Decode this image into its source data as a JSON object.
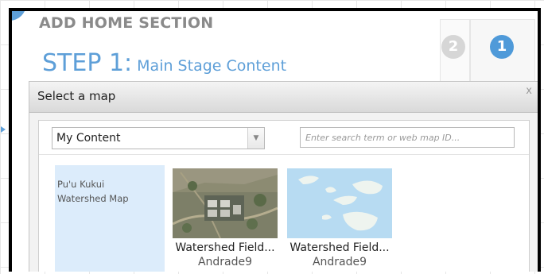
{
  "wizard": {
    "title": "ADD HOME SECTION",
    "step_label": "STEP 1:",
    "step_name": "Main Stage Content",
    "steps": [
      {
        "number": "2",
        "active": false
      },
      {
        "number": "1",
        "active": true
      }
    ]
  },
  "modal": {
    "title": "Select a map",
    "close_label": "x",
    "content_select": {
      "value": "My Content"
    },
    "search": {
      "placeholder": "Enter search term or web map ID..."
    },
    "sidebar": {
      "items": [
        {
          "label": "Pu'u Kukui Watershed Map"
        }
      ]
    },
    "maps": [
      {
        "title": "Watershed Field...",
        "owner": "Andrade9",
        "thumbnail": "aerial-imagery"
      },
      {
        "title": "Watershed Field...",
        "owner": "Andrade9",
        "thumbnail": "islands-basemap"
      }
    ]
  },
  "colors": {
    "accent": "#5e9fd8",
    "step_active": "#4f9ad9",
    "step_inactive": "#d6d6d6",
    "selection_bg": "#dcecfb"
  },
  "icons": {
    "dropdown": "chevron-down-icon",
    "close": "close-icon",
    "side_pointer": "triangle-right-icon"
  }
}
